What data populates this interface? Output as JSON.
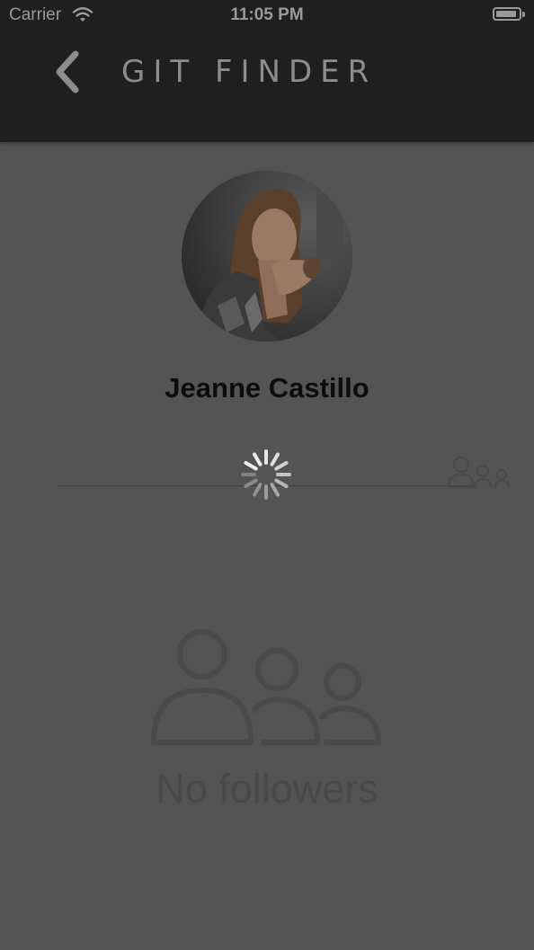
{
  "status_bar": {
    "carrier": "Carrier",
    "time": "11:05 PM",
    "wifi_icon": "wifi-icon",
    "battery_icon": "battery-icon"
  },
  "nav": {
    "title": "GIT FINDER",
    "back_icon": "chevron-left-icon"
  },
  "profile": {
    "name": "Jeanne Castillo",
    "avatar_icon": "avatar-photo"
  },
  "tabs": {
    "followers_icon": "people-icon"
  },
  "loading": {
    "spinner_icon": "activity-spinner-icon"
  },
  "empty_state": {
    "icon": "people-icon",
    "text": "No followers"
  },
  "colors": {
    "overlay_background": "#545454",
    "nav_background": "#1f1f1f",
    "nav_text": "#8d8d8d",
    "empty_text": "#494949"
  }
}
